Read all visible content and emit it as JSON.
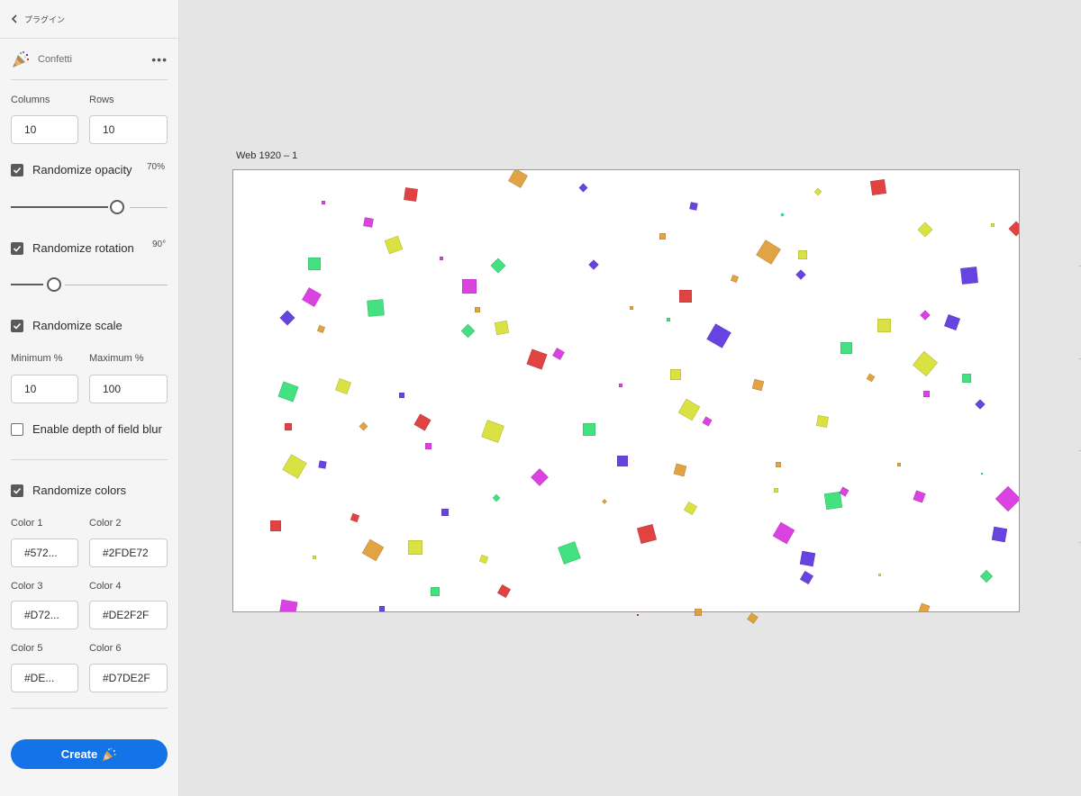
{
  "header": {
    "back_label": "プラグイン"
  },
  "plugin": {
    "name": "Confetti",
    "icon": "party-popper-icon",
    "more_icon": "more-dots-icon"
  },
  "grid": {
    "columns_label": "Columns",
    "columns_value": "10",
    "rows_label": "Rows",
    "rows_value": "10"
  },
  "opacity": {
    "label": "Randomize opacity",
    "checked": true,
    "value_text": "70%",
    "value": 70
  },
  "rotation": {
    "label": "Randomize rotation",
    "checked": true,
    "value_text": "90°",
    "value": 90
  },
  "scale": {
    "label": "Randomize scale",
    "checked": true,
    "min_label": "Minimum %",
    "min_value": "10",
    "max_label": "Maximum %",
    "max_value": "100"
  },
  "blur": {
    "label": "Enable depth of field blur",
    "checked": false
  },
  "colors": {
    "label": "Randomize colors",
    "checked": true,
    "items": [
      {
        "label": "Color 1",
        "value": "#572..."
      },
      {
        "label": "Color 2",
        "value": "#2FDE72"
      },
      {
        "label": "Color 3",
        "value": "#D72..."
      },
      {
        "label": "Color 4",
        "value": "#DE2F2F"
      },
      {
        "label": "Color 5",
        "value": "#DE..."
      },
      {
        "label": "Color 6",
        "value": "#D7DE2F"
      }
    ]
  },
  "create_button": {
    "label": "Create",
    "icon": "party-popper-icon"
  },
  "artboard": {
    "title": "Web 1920 – 1"
  },
  "theme": {
    "accent": "#1473e6",
    "confetti_palette": [
      "#572FDE",
      "#2FDE72",
      "#D72FDE",
      "#DE2F2F",
      "#DE9A2F",
      "#D7DE2F",
      "#02E89A",
      "#8F4FE8"
    ]
  }
}
